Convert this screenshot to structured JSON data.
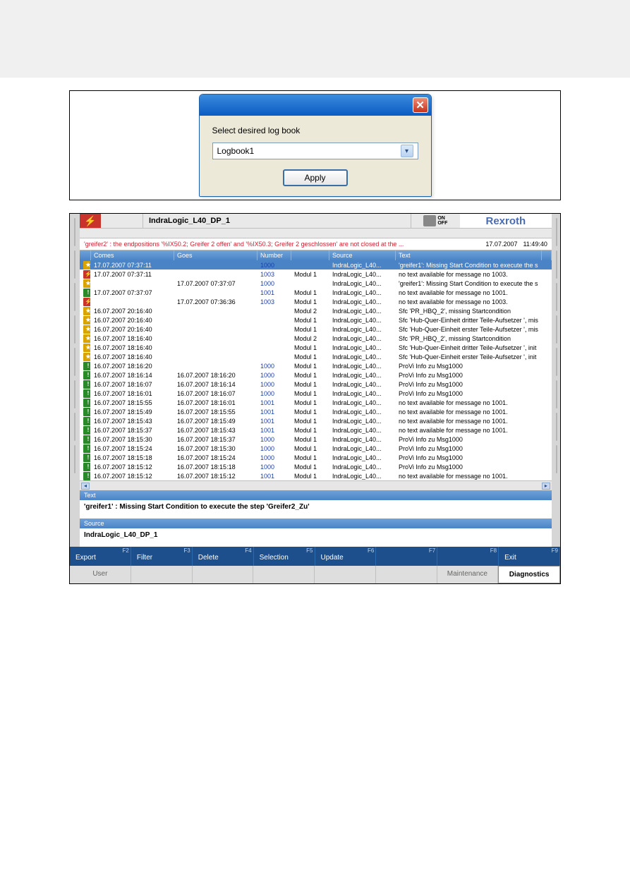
{
  "dialog": {
    "label": "Select desired log book",
    "value": "Logbook1",
    "apply": "Apply"
  },
  "app": {
    "title": "IndraLogic_L40_DP_1",
    "toggle": {
      "on": "ON",
      "off": "OFF"
    },
    "brand": "Rexroth",
    "warning": {
      "msg": "'greifer2' : the endpositions '%IX50.2; Greifer 2 offen' and '%IX50.3; Greifer 2 geschlossen' are not closed at the ...",
      "date": "17.07.2007",
      "time": "11:49:40"
    },
    "columns": {
      "comes": "Comes",
      "goes": "Goes",
      "number": "Number",
      "source": "Source",
      "text": "Text"
    },
    "rows": [
      {
        "icon": "yel",
        "comes": "17.07.2007  07:37:11",
        "goes": "",
        "num": "1000",
        "gap": "",
        "src": "IndraLogic_L40...",
        "text": "'greifer1': Missing Start Condition to execute the s",
        "sel": true
      },
      {
        "icon": "red",
        "comes": "17.07.2007  07:37:11",
        "goes": "",
        "num": "1003",
        "gap": "Modul 1",
        "src": "IndraLogic_L40...",
        "text": "no text available for message no 1003."
      },
      {
        "icon": "yel",
        "comes": "",
        "goes": "17.07.2007  07:37:07",
        "num": "1000",
        "gap": "",
        "src": "IndraLogic_L40...",
        "text": "'greifer1': Missing Start Condition to execute the s"
      },
      {
        "icon": "grn",
        "comes": "17.07.2007  07:37:07",
        "goes": "",
        "num": "1001",
        "gap": "Modul 1",
        "src": "IndraLogic_L40...",
        "text": "no text available for message no 1001."
      },
      {
        "icon": "red",
        "comes": "",
        "goes": "17.07.2007  07:36:36",
        "num": "1003",
        "gap": "Modul 1",
        "src": "IndraLogic_L40...",
        "text": "no text available for message no 1003."
      },
      {
        "icon": "yel",
        "comes": "16.07.2007  20:16:40",
        "goes": "",
        "num": "",
        "gap": "Modul 2",
        "src": "IndraLogic_L40...",
        "text": "Sfc 'PR_HBQ_2', missing Startcondition"
      },
      {
        "icon": "yel",
        "comes": "16.07.2007  20:16:40",
        "goes": "",
        "num": "",
        "gap": "Modul 1",
        "src": "IndraLogic_L40...",
        "text": "Sfc 'Hub-Quer-Einheit dritter Teile-Aufsetzer ', mis"
      },
      {
        "icon": "yel",
        "comes": "16.07.2007  20:16:40",
        "goes": "",
        "num": "",
        "gap": "Modul 1",
        "src": "IndraLogic_L40...",
        "text": "Sfc 'Hub-Quer-Einheit erster Teile-Aufsetzer ', mis"
      },
      {
        "icon": "yel",
        "comes": "16.07.2007  18:16:40",
        "goes": "",
        "num": "",
        "gap": "Modul 2",
        "src": "IndraLogic_L40...",
        "text": "Sfc 'PR_HBQ_2', missing Startcondition"
      },
      {
        "icon": "yel",
        "comes": "16.07.2007  18:16:40",
        "goes": "",
        "num": "",
        "gap": "Modul 1",
        "src": "IndraLogic_L40...",
        "text": "Sfc 'Hub-Quer-Einheit dritter Teile-Aufsetzer ', init"
      },
      {
        "icon": "yel",
        "comes": "16.07.2007  18:16:40",
        "goes": "",
        "num": "",
        "gap": "Modul 1",
        "src": "IndraLogic_L40...",
        "text": "Sfc 'Hub-Quer-Einheit erster Teile-Aufsetzer ', init"
      },
      {
        "icon": "grn",
        "comes": "16.07.2007  18:16:20",
        "goes": "",
        "num": "1000",
        "gap": "Modul 1",
        "src": "IndraLogic_L40...",
        "text": "ProVi Info zu Msg1000"
      },
      {
        "icon": "grn",
        "comes": "16.07.2007  18:16:14",
        "goes": "16.07.2007  18:16:20",
        "num": "1000",
        "gap": "Modul 1",
        "src": "IndraLogic_L40...",
        "text": "ProVi Info zu Msg1000"
      },
      {
        "icon": "grn",
        "comes": "16.07.2007  18:16:07",
        "goes": "16.07.2007  18:16:14",
        "num": "1000",
        "gap": "Modul 1",
        "src": "IndraLogic_L40...",
        "text": "ProVi Info zu Msg1000"
      },
      {
        "icon": "grn",
        "comes": "16.07.2007  18:16:01",
        "goes": "16.07.2007  18:16:07",
        "num": "1000",
        "gap": "Modul 1",
        "src": "IndraLogic_L40...",
        "text": "ProVi Info zu Msg1000"
      },
      {
        "icon": "grn",
        "comes": "16.07.2007  18:15:55",
        "goes": "16.07.2007  18:16:01",
        "num": "1001",
        "gap": "Modul 1",
        "src": "IndraLogic_L40...",
        "text": "no text available for message no 1001."
      },
      {
        "icon": "grn",
        "comes": "16.07.2007  18:15:49",
        "goes": "16.07.2007  18:15:55",
        "num": "1001",
        "gap": "Modul 1",
        "src": "IndraLogic_L40...",
        "text": "no text available for message no 1001."
      },
      {
        "icon": "grn",
        "comes": "16.07.2007  18:15:43",
        "goes": "16.07.2007  18:15:49",
        "num": "1001",
        "gap": "Modul 1",
        "src": "IndraLogic_L40...",
        "text": "no text available for message no 1001."
      },
      {
        "icon": "grn",
        "comes": "16.07.2007  18:15:37",
        "goes": "16.07.2007  18:15:43",
        "num": "1001",
        "gap": "Modul 1",
        "src": "IndraLogic_L40...",
        "text": "no text available for message no 1001."
      },
      {
        "icon": "grn",
        "comes": "16.07.2007  18:15:30",
        "goes": "16.07.2007  18:15:37",
        "num": "1000",
        "gap": "Modul 1",
        "src": "IndraLogic_L40...",
        "text": "ProVi Info zu Msg1000"
      },
      {
        "icon": "grn",
        "comes": "16.07.2007  18:15:24",
        "goes": "16.07.2007  18:15:30",
        "num": "1000",
        "gap": "Modul 1",
        "src": "IndraLogic_L40...",
        "text": "ProVi Info zu Msg1000"
      },
      {
        "icon": "grn",
        "comes": "16.07.2007  18:15:18",
        "goes": "16.07.2007  18:15:24",
        "num": "1000",
        "gap": "Modul 1",
        "src": "IndraLogic_L40...",
        "text": "ProVi Info zu Msg1000"
      },
      {
        "icon": "grn",
        "comes": "16.07.2007  18:15:12",
        "goes": "16.07.2007  18:15:18",
        "num": "1000",
        "gap": "Modul 1",
        "src": "IndraLogic_L40...",
        "text": "ProVi Info zu Msg1000"
      },
      {
        "icon": "grn",
        "comes": "16.07.2007  18:15:12",
        "goes": "16.07.2007  18:15:12",
        "num": "1001",
        "gap": "Modul 1",
        "src": "IndraLogic_L40...",
        "text": "no text available for message no 1001."
      }
    ],
    "section_text": {
      "title": "Text",
      "body": "'greifer1' : Missing Start Condition to execute the step 'Greifer2_Zu'"
    },
    "section_source": {
      "title": "Source",
      "body": "IndraLogic_L40_DP_1"
    },
    "fkeys": [
      {
        "hot": "F2",
        "label": "Export"
      },
      {
        "hot": "F3",
        "label": "Filter"
      },
      {
        "hot": "F4",
        "label": "Delete"
      },
      {
        "hot": "F5",
        "label": "Selection"
      },
      {
        "hot": "F6",
        "label": "Update"
      },
      {
        "hot": "F7",
        "label": ""
      },
      {
        "hot": "F8",
        "label": ""
      },
      {
        "hot": "F9",
        "label": "Exit"
      }
    ],
    "bottom": {
      "user": "User",
      "maintenance": "Maintenance",
      "diagnostics": "Diagnostics"
    }
  }
}
